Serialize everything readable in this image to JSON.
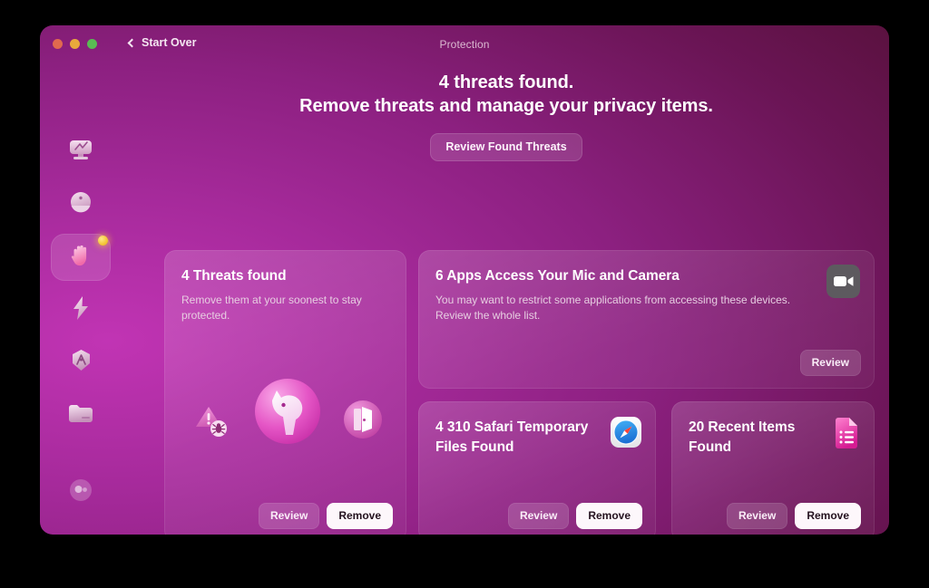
{
  "window": {
    "title": "Protection",
    "back_label": "Start Over",
    "traffic_lights": [
      "close",
      "minimize",
      "zoom"
    ]
  },
  "hero": {
    "line1": "4 threats found.",
    "line2": "Remove threats and manage your privacy items.",
    "cta_label": "Review Found Threats"
  },
  "sidebar": {
    "items": [
      {
        "name": "smart-scan",
        "icon": "monitor-icon",
        "selected": false
      },
      {
        "name": "cleanup",
        "icon": "capsule-icon",
        "selected": false
      },
      {
        "name": "protection",
        "icon": "hand-icon",
        "selected": true,
        "badge": true
      },
      {
        "name": "performance",
        "icon": "lightning-bolt-icon",
        "selected": false
      },
      {
        "name": "applications",
        "icon": "shield-hexagon-icon",
        "selected": false
      },
      {
        "name": "my-stuff",
        "icon": "folder-icon",
        "selected": false
      }
    ],
    "account": {
      "name": "account",
      "icon": "avatar-icon"
    }
  },
  "cards": {
    "threats": {
      "title": "4 Threats found",
      "desc": "Remove them at your soonest to stay protected.",
      "review_label": "Review",
      "remove_label": "Remove",
      "art": [
        "warning-bug-icon",
        "trojan-horse-icon",
        "backdoor-door-icon"
      ]
    },
    "mic": {
      "title": "6 Apps Access Your Mic and Camera",
      "desc": "You may want to restrict some applications from accessing these devices. Review the whole list.",
      "review_label": "Review",
      "icon": "video-camera-icon"
    },
    "safari": {
      "title": "4 310 Safari Temporary Files Found",
      "review_label": "Review",
      "remove_label": "Remove",
      "icon": "safari-compass-icon"
    },
    "recent": {
      "title": "20 Recent Items Found",
      "review_label": "Review",
      "remove_label": "Remove",
      "icon": "document-list-icon"
    }
  },
  "colors": {
    "window_left": "#c134b4",
    "window_right": "#4a0d2c",
    "accent_pink": "#ef5fd0",
    "badge_yellow": "#f5c93c",
    "safari_blue": "#3c9bf0",
    "traffic_red": "#e0694f",
    "traffic_yellow": "#e8a93b",
    "traffic_green": "#5aba54"
  }
}
